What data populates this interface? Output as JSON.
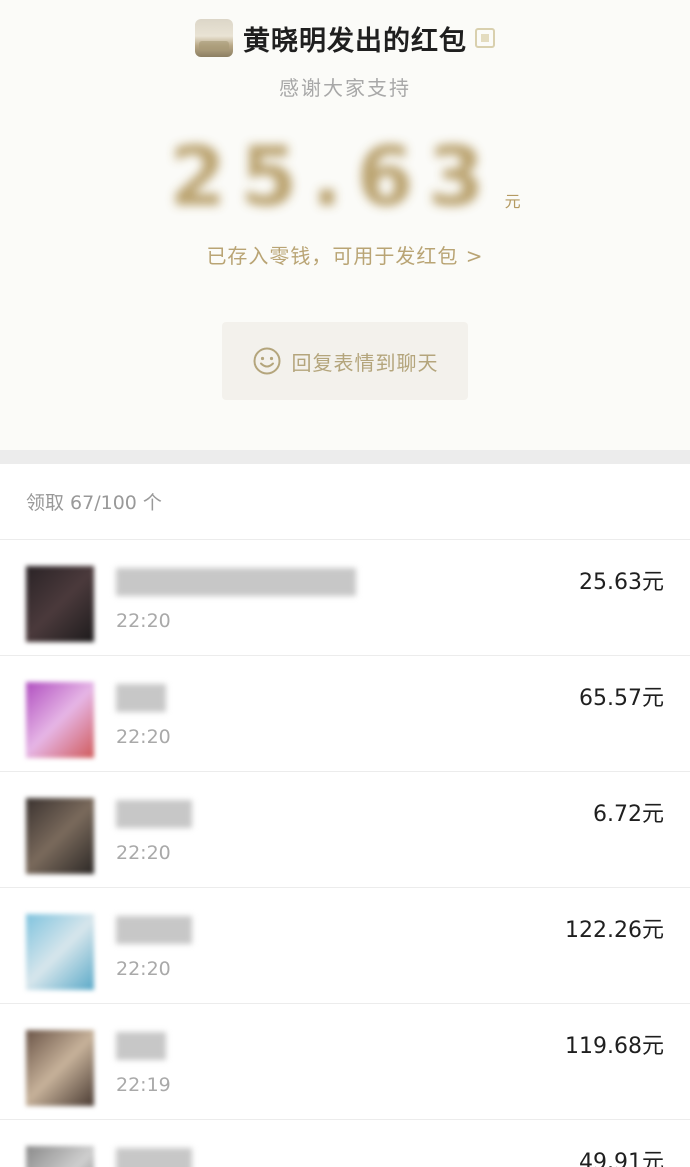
{
  "header": {
    "sender_name": "黄晓明发出的红包",
    "blessing": "感谢大家支持",
    "amount": "25.63",
    "amount_unit": "元",
    "stored_note": "已存入零钱，可用于发红包 >",
    "reply_label": "回复表情到聊天",
    "icons": {
      "reply": "smile-icon"
    }
  },
  "summary": {
    "count_text": "领取 67/100 个"
  },
  "receivers": [
    {
      "time": "22:20",
      "amount": "25.63元",
      "avatar_colors": [
        "#2a2326",
        "#4b3a3c",
        "#1d1b1c"
      ]
    },
    {
      "time": "22:20",
      "amount": "65.57元",
      "avatar_colors": [
        "#b04fc0",
        "#e6b6e6",
        "#d05a5a"
      ]
    },
    {
      "time": "22:20",
      "amount": "6.72元",
      "avatar_colors": [
        "#3b3330",
        "#7a6a5c",
        "#2c2826"
      ]
    },
    {
      "time": "22:20",
      "amount": "122.26元",
      "avatar_colors": [
        "#7fc3de",
        "#d7e6ec",
        "#5aa9c8"
      ]
    },
    {
      "time": "22:19",
      "amount": "119.68元",
      "avatar_colors": [
        "#6b5548",
        "#c7b29a",
        "#4a3b33"
      ]
    },
    {
      "time": "",
      "amount": "49.91元",
      "avatar_colors": [
        "#8a8a8a",
        "#cfcfcf",
        "#5d5d5d"
      ]
    }
  ],
  "colors": {
    "gold": "#b49a62",
    "background": "#fbfbf8",
    "divider": "#ececec"
  }
}
